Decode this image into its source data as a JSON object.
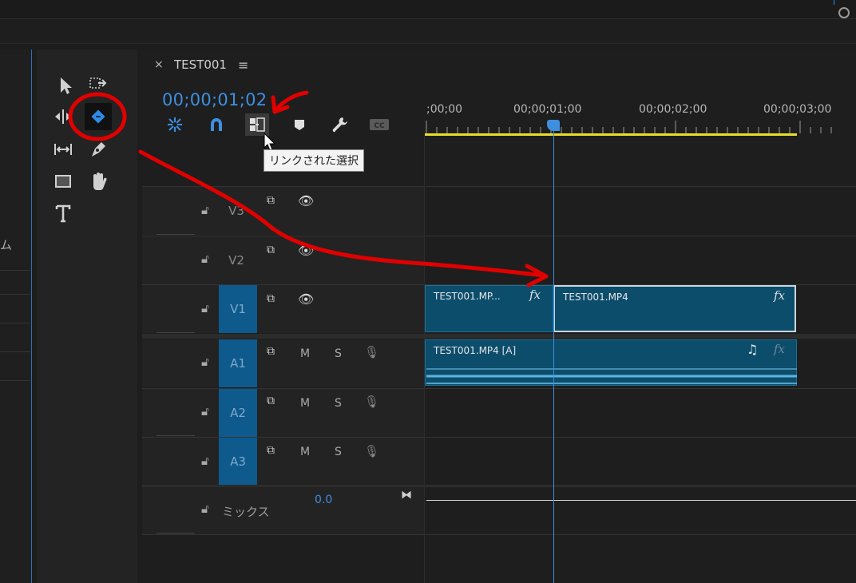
{
  "left_panel": {
    "partial_text": "ム"
  },
  "sequence": {
    "tab_title": "TEST001",
    "timecode": "00;00;01;02",
    "tooltip": "リンクされた選択"
  },
  "ruler": {
    "labels": [
      ";00;00",
      "00;00;01;00",
      "00;00;02;00",
      "00;00;03;00"
    ]
  },
  "tracks": {
    "video": [
      {
        "name": "V3",
        "selected": false
      },
      {
        "name": "V2",
        "selected": false
      },
      {
        "name": "V1",
        "selected": true
      }
    ],
    "audio": [
      {
        "name": "A1",
        "selected": true,
        "m": "M",
        "s": "S"
      },
      {
        "name": "A2",
        "selected": true,
        "m": "M",
        "s": "S"
      },
      {
        "name": "A3",
        "selected": true,
        "m": "M",
        "s": "S"
      }
    ],
    "mix": {
      "name": "ミックス",
      "value": "0.0"
    }
  },
  "clips": {
    "v1_a": {
      "name": "TEST001.MP...",
      "fx": "fx"
    },
    "v1_b": {
      "name": "TEST001.MP4",
      "fx": "fx"
    },
    "a1": {
      "name": "TEST001.MP4 [A]",
      "fx": "fx"
    }
  },
  "colors": {
    "accent": "#3d8fe0",
    "track_selected": "#0f5a8c",
    "clip": "#0c4d6c",
    "work_area": "#e8de2a",
    "annotation": "#e00000"
  },
  "icons": {
    "tools": [
      "selection-tool-icon",
      "track-select-tool-icon",
      "ripple-edit-tool-icon",
      "razor-tool-icon",
      "slip-tool-icon",
      "pen-tool-icon",
      "rectangle-tool-icon",
      "hand-tool-icon",
      "type-tool-icon"
    ],
    "timeline_buttons": [
      "nest-icon",
      "snap-icon",
      "linked-selection-icon",
      "add-marker-icon",
      "settings-wrench-icon",
      "captions-icon"
    ]
  }
}
